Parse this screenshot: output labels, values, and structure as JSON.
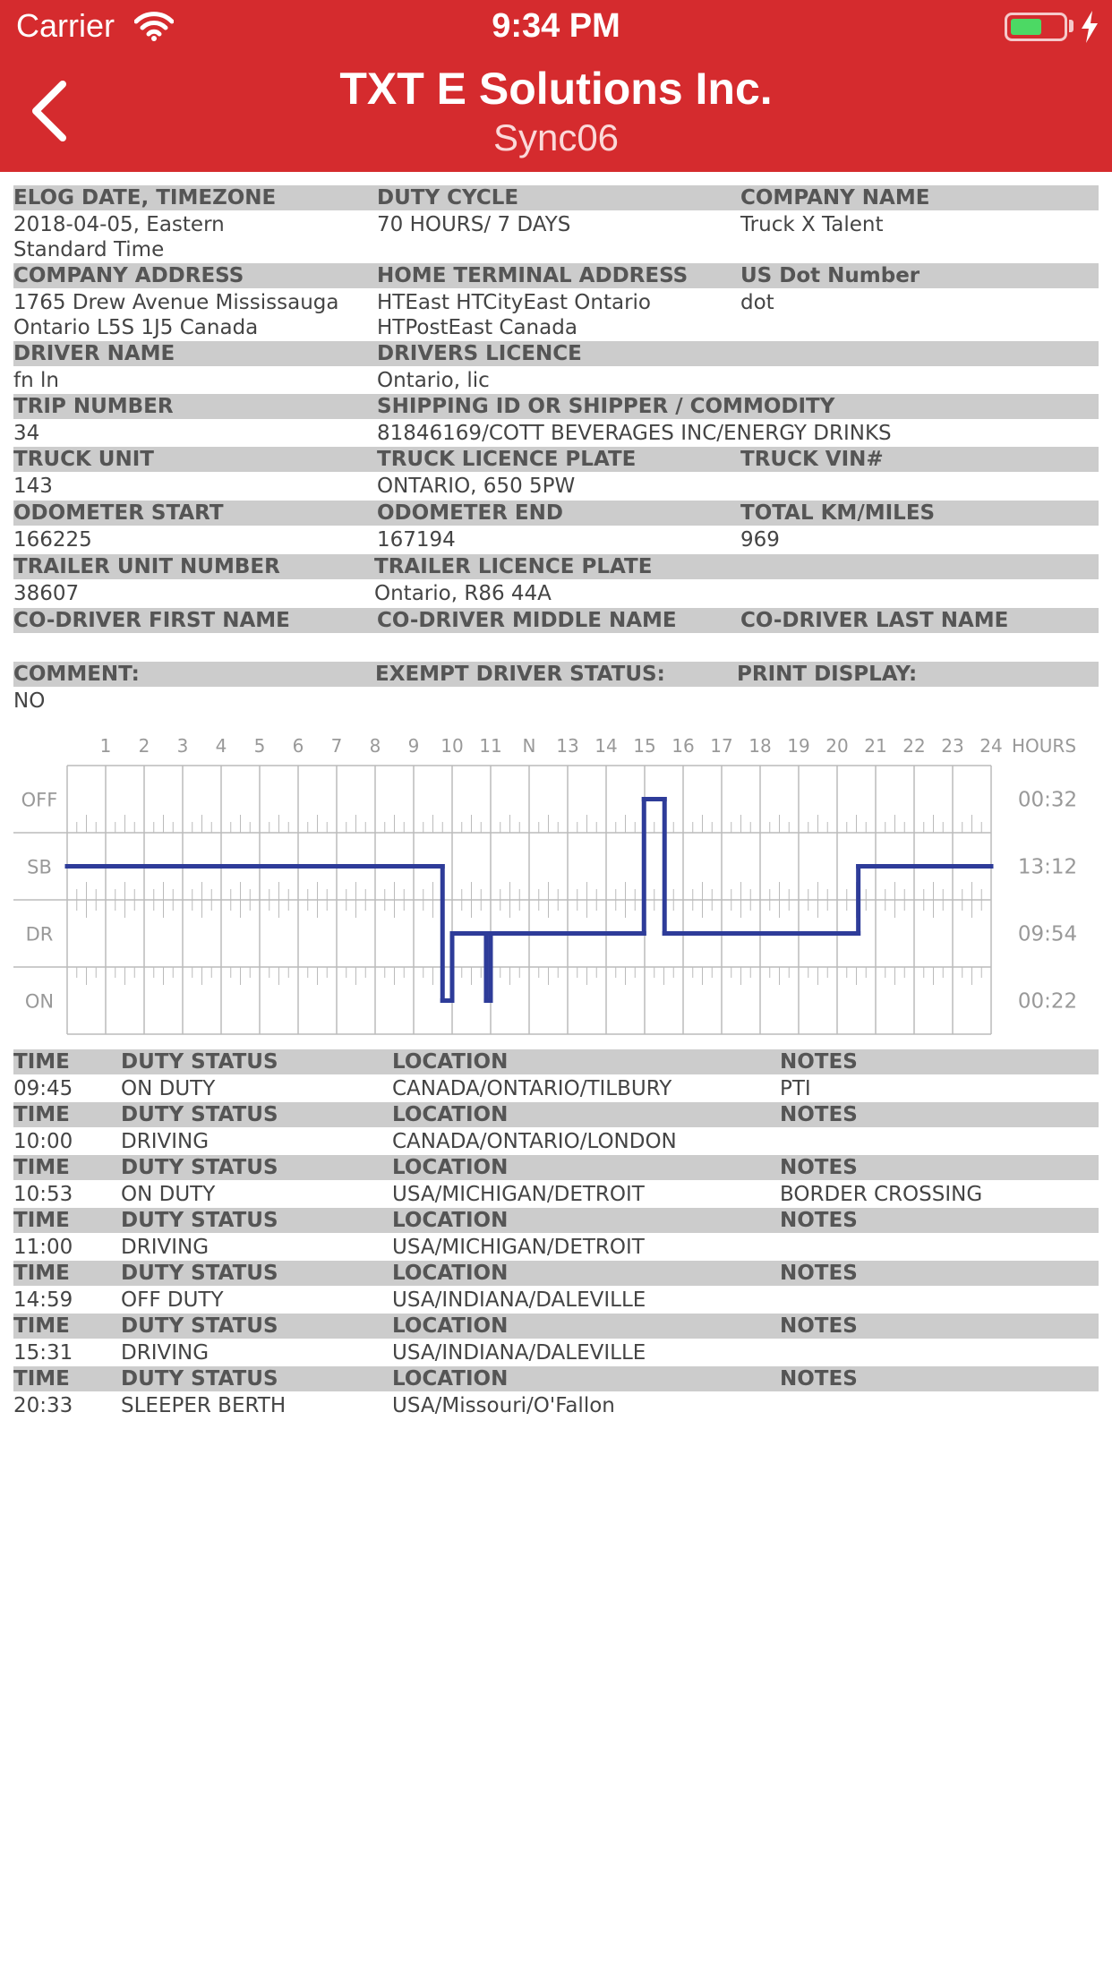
{
  "status_bar": {
    "carrier": "Carrier",
    "time": "9:34 PM",
    "battery_level": 0.6
  },
  "nav": {
    "title": "TXT E Solutions Inc.",
    "subtitle": "Sync06"
  },
  "log": {
    "elog_date_label": "ELOG DATE, TIMEZONE",
    "elog_date_line1": "2018-04-05, Eastern",
    "elog_date_line2": "Standard Time",
    "duty_cycle_label": "DUTY CYCLE",
    "duty_cycle": "70 HOURS/ 7 DAYS",
    "company_name_label": "COMPANY NAME",
    "company_name": "Truck X Talent",
    "company_address_label": "COMPANY ADDRESS",
    "company_address_line1": "1765 Drew Avenue Mississauga",
    "company_address_line2": "Ontario L5S 1J5 Canada",
    "home_terminal_label": "HOME TERMINAL ADDRESS",
    "home_terminal_line1": "HTEast HTCityEast Ontario",
    "home_terminal_line2": "HTPostEast Canada",
    "us_dot_label": "US Dot Number",
    "us_dot": "dot",
    "driver_name_label": "DRIVER NAME",
    "driver_name": "fn ln",
    "drivers_licence_label": "DRIVERS LICENCE",
    "drivers_licence": "Ontario, lic",
    "trip_number_label": "TRIP NUMBER",
    "trip_number": "34",
    "shipping_label": "SHIPPING ID OR SHIPPER / COMMODITY",
    "shipping": "81846169/COTT BEVERAGES INC/ENERGY DRINKS",
    "truck_unit_label": "TRUCK UNIT",
    "truck_unit": "143",
    "truck_plate_label": "TRUCK LICENCE PLATE",
    "truck_plate": "ONTARIO, 650 5PW",
    "truck_vin_label": "TRUCK VIN#",
    "odometer_start_label": "ODOMETER START",
    "odometer_start": "166225",
    "odometer_end_label": "ODOMETER END",
    "odometer_end": "167194",
    "total_label": "TOTAL KM/MILES",
    "total": "969",
    "trailer_unit_label": "TRAILER UNIT NUMBER",
    "trailer_unit": "38607",
    "trailer_plate_label": "TRAILER LICENCE PLATE",
    "trailer_plate": "Ontario, R86 44A",
    "codriver_first_label": "CO-DRIVER FIRST NAME",
    "codriver_middle_label": "CO-DRIVER MIDDLE NAME",
    "codriver_last_label": "CO-DRIVER LAST NAME",
    "comment_label": "COMMENT:",
    "exempt_label": "EXEMPT DRIVER STATUS:",
    "print_display_label": "PRINT DISPLAY:",
    "exempt_value": "NO"
  },
  "chart_data": {
    "type": "line",
    "x_tick_labels": [
      "1",
      "2",
      "3",
      "4",
      "5",
      "6",
      "7",
      "8",
      "9",
      "10",
      "11",
      "N",
      "13",
      "14",
      "15",
      "16",
      "17",
      "18",
      "19",
      "20",
      "21",
      "22",
      "23",
      "24"
    ],
    "x_unit_label": "HOURS",
    "xlim": [
      0,
      24
    ],
    "rows": [
      "OFF",
      "SB",
      "DR",
      "ON"
    ],
    "row_totals": [
      "00:32",
      "13:12",
      "09:54",
      "00:22"
    ],
    "line_color": "#2e3c99",
    "segments": [
      {
        "start": 0,
        "end": 9.75,
        "status": "SB"
      },
      {
        "start": 9.75,
        "end": 10.0,
        "status": "ON"
      },
      {
        "start": 10.0,
        "end": 10.883,
        "status": "DR"
      },
      {
        "start": 10.883,
        "end": 11.0,
        "status": "ON"
      },
      {
        "start": 11.0,
        "end": 14.983,
        "status": "DR"
      },
      {
        "start": 14.983,
        "end": 15.517,
        "status": "OFF"
      },
      {
        "start": 15.517,
        "end": 20.55,
        "status": "DR"
      },
      {
        "start": 20.55,
        "end": 24,
        "status": "SB"
      }
    ]
  },
  "events_header": {
    "time": "TIME",
    "status": "DUTY STATUS",
    "location": "LOCATION",
    "notes": "NOTES"
  },
  "events": [
    {
      "time": "09:45",
      "status": "ON DUTY",
      "location": "CANADA/ONTARIO/TILBURY",
      "notes": "PTI"
    },
    {
      "time": "10:00",
      "status": "DRIVING",
      "location": "CANADA/ONTARIO/LONDON",
      "notes": ""
    },
    {
      "time": "10:53",
      "status": "ON DUTY",
      "location": "USA/MICHIGAN/DETROIT",
      "notes": "BORDER CROSSING"
    },
    {
      "time": "11:00",
      "status": "DRIVING",
      "location": "USA/MICHIGAN/DETROIT",
      "notes": ""
    },
    {
      "time": "14:59",
      "status": "OFF DUTY",
      "location": "USA/INDIANA/DALEVILLE",
      "notes": ""
    },
    {
      "time": "15:31",
      "status": "DRIVING",
      "location": "USA/INDIANA/DALEVILLE",
      "notes": ""
    },
    {
      "time": "20:33",
      "status": "SLEEPER BERTH",
      "location": "USA/Missouri/O'Fallon",
      "notes": ""
    }
  ]
}
